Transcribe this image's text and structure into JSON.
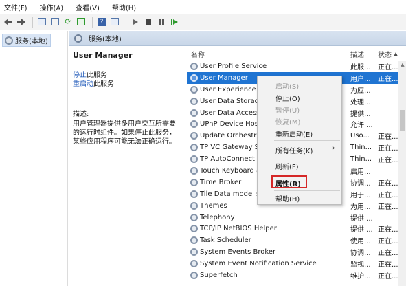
{
  "menu": [
    "文件(F)",
    "操作(A)",
    "查看(V)",
    "帮助(H)"
  ],
  "toolbar_icons": [
    "back-arrow-icon",
    "forward-arrow-icon",
    "console-tree-icon",
    "properties-sheet-icon",
    "refresh-icon",
    "export-list-icon",
    "help-icon",
    "view-icon",
    "play-icon",
    "stop-icon",
    "pause-icon",
    "restart-icon"
  ],
  "tree": {
    "root_label": "服务(本地)"
  },
  "header": {
    "title": "服务(本地)"
  },
  "detail": {
    "service_name": "User Manager",
    "stop_link": "停止",
    "stop_suffix": "此服务",
    "restart_link": "重启动",
    "restart_suffix": "此服务",
    "desc_label": "描述:",
    "desc_text": "用户管理器提供多用户交互所需要的运行时组件。如果停止此服务，某些应用程序可能无法正确运行。"
  },
  "columns": {
    "name": "名称",
    "desc": "描述",
    "status": "状态"
  },
  "services": [
    {
      "name": "User Profile Service",
      "desc": "此服...",
      "status": "正在..."
    },
    {
      "name": "User Manager",
      "desc": "用户...",
      "status": "正在..."
    },
    {
      "name": "User Experience V",
      "desc": "为应...",
      "status": ""
    },
    {
      "name": "User Data Storag",
      "desc": "处理...",
      "status": ""
    },
    {
      "name": "User Data Access",
      "desc": "提供...",
      "status": ""
    },
    {
      "name": "UPnP Device Host",
      "desc": "允许 ...",
      "status": ""
    },
    {
      "name": "Update Orchestra",
      "desc": "Uso...",
      "status": "正在..."
    },
    {
      "name": "TP VC Gateway Se",
      "desc": "Thin...",
      "status": "正在..."
    },
    {
      "name": "TP AutoConnect S",
      "desc": "Thin...",
      "status": "正在..."
    },
    {
      "name": "Touch Keyboard a",
      "desc": "启用...",
      "status": ""
    },
    {
      "name": "Time Broker",
      "desc": "协调...",
      "status": "正在..."
    },
    {
      "name": "Tile Data model s",
      "desc": "用于...",
      "status": "正在..."
    },
    {
      "name": "Themes",
      "desc": "为用...",
      "status": "正在..."
    },
    {
      "name": "Telephony",
      "desc": "提供 ...",
      "status": ""
    },
    {
      "name": "TCP/IP NetBIOS Helper",
      "desc": "提供 ...",
      "status": "正在..."
    },
    {
      "name": "Task Scheduler",
      "desc": "使用...",
      "status": "正在..."
    },
    {
      "name": "System Events Broker",
      "desc": "协调...",
      "status": "正在..."
    },
    {
      "name": "System Event Notification Service",
      "desc": "监视...",
      "status": "正在..."
    },
    {
      "name": "Superfetch",
      "desc": "维护...",
      "status": "正在..."
    }
  ],
  "context_menu": {
    "start": "启动(S)",
    "stop": "停止(O)",
    "pause": "暂停(U)",
    "resume": "恢复(M)",
    "restart": "重新启动(E)",
    "all_tasks": "所有任务(K)",
    "refresh": "刷新(F)",
    "properties": "属性(R)",
    "help": "帮助(H)",
    "highlight_color": "#d52727"
  },
  "colors": {
    "selection": "#1f74d2",
    "link": "#1b56b8",
    "header_bg": "#c8d6e8"
  }
}
